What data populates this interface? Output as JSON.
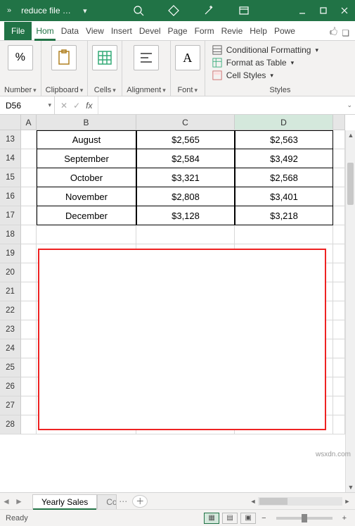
{
  "title": "reduce file si...",
  "tabs": {
    "file": "File",
    "home": "Hom",
    "data": "Data",
    "view": "View",
    "insert": "Insert",
    "devel": "Devel",
    "page": "Page",
    "form": "Form",
    "revie": "Revie",
    "help": "Help",
    "powe": "Powe"
  },
  "ribbon": {
    "number": "Number",
    "number_sym": "%",
    "clipboard": "Clipboard",
    "cells": "Cells",
    "alignment": "Alignment",
    "font": "Font",
    "styles": "Styles",
    "cond_fmt": "Conditional Formatting",
    "fmt_table": "Format as Table",
    "cell_styles": "Cell Styles"
  },
  "namebox": "D56",
  "fx": "fx",
  "columns": {
    "A": "A",
    "B": "B",
    "C": "C",
    "D": "D"
  },
  "rows": [
    "13",
    "14",
    "15",
    "16",
    "17",
    "18",
    "19",
    "20",
    "21",
    "22",
    "23",
    "24",
    "25",
    "26",
    "27",
    "28"
  ],
  "data": [
    {
      "b": "August",
      "c": "$2,565",
      "d": "$2,563"
    },
    {
      "b": "September",
      "c": "$2,584",
      "d": "$3,492"
    },
    {
      "b": "October",
      "c": "$3,321",
      "d": "$2,568"
    },
    {
      "b": "November",
      "c": "$2,808",
      "d": "$3,401"
    },
    {
      "b": "December",
      "c": "$3,128",
      "d": "$3,218"
    }
  ],
  "sheets": {
    "active": "Yearly Sales",
    "next": "Co"
  },
  "status": "Ready",
  "watermark": "wsxdn.com"
}
